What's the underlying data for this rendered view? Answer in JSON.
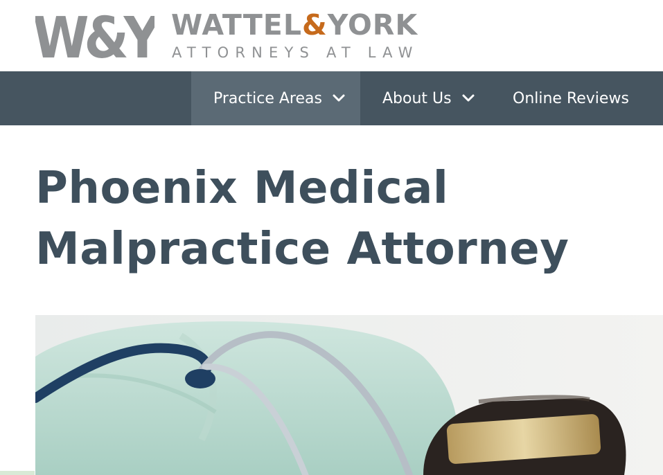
{
  "brand": {
    "logo_monogram": "W&Y",
    "name_part1": "WATTEL",
    "name_amp": "&",
    "name_part2": "YORK",
    "tagline": "ATTORNEYS AT LAW",
    "colors": {
      "gray": "#8f9193",
      "orange": "#c66a1c"
    }
  },
  "nav": {
    "background": "#465560",
    "active_background": "#5b6a75",
    "items": [
      {
        "label": "Practice Areas",
        "has_dropdown": true,
        "active": true
      },
      {
        "label": "About Us",
        "has_dropdown": true,
        "active": false
      },
      {
        "label": "Online Reviews",
        "has_dropdown": false,
        "active": false
      }
    ]
  },
  "page": {
    "title": "Phoenix Medical Malpractice Attorney",
    "title_color": "#3e4f5c"
  },
  "hero_image": {
    "subject": "stethoscope-and-gavel-photo"
  }
}
